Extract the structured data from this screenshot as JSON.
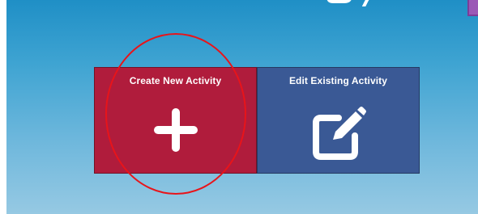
{
  "page": {
    "background_gradient": [
      "#1f8fc6",
      "#96c9e3"
    ],
    "corner_accent_color": "#9b59b6"
  },
  "tiles": [
    {
      "label": "Create New Activity",
      "icon": "plus-icon",
      "color": "#b01c3c"
    },
    {
      "label": "Edit Existing Activity",
      "icon": "edit-pencil-icon",
      "color": "#3a5995"
    }
  ],
  "annotation": {
    "shape": "ellipse",
    "color": "#e8141a",
    "target": "create-new-activity-tile"
  }
}
